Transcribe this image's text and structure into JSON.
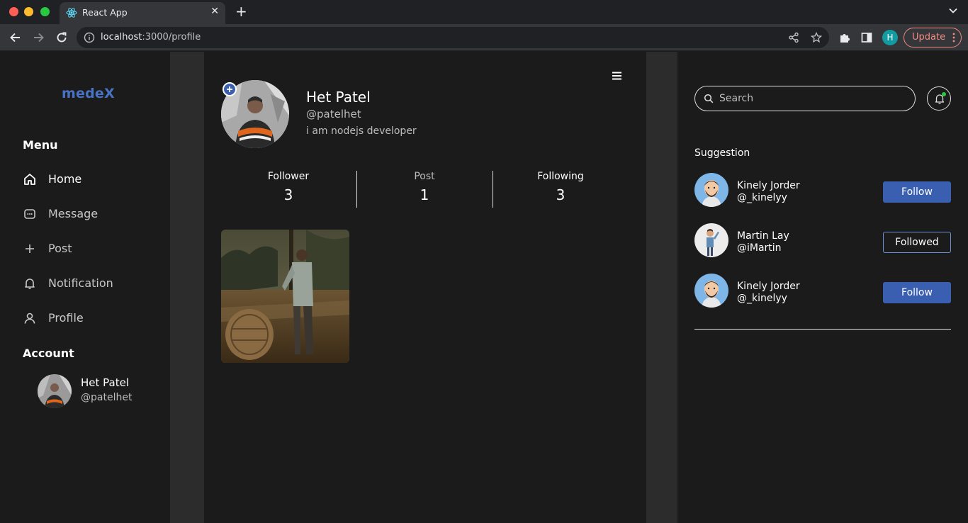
{
  "browser": {
    "tab_title": "React App",
    "url_host": "localhost",
    "url_rest": ":3000/profile",
    "profile_initial": "H",
    "update_label": "Update"
  },
  "app": {
    "logo": "medeX",
    "menu_heading": "Menu",
    "menu": [
      {
        "label": "Home"
      },
      {
        "label": "Message"
      },
      {
        "label": "Post"
      },
      {
        "label": "Notification"
      },
      {
        "label": "Profile"
      }
    ],
    "account_heading": "Account",
    "account": {
      "name": "Het Patel",
      "handle": "@patelhet"
    }
  },
  "profile": {
    "name": "Het Patel",
    "handle": "@patelhet",
    "bio": "i am nodejs developer",
    "stats": [
      {
        "label": "Follower",
        "value": "3"
      },
      {
        "label": "Post",
        "value": "1"
      },
      {
        "label": "Following",
        "value": "3"
      }
    ]
  },
  "right": {
    "search_placeholder": "Search",
    "suggestion_title": "Suggestion",
    "suggestions": [
      {
        "name": "Kinely Jorder",
        "handle": "@_kinelyy",
        "button": "Follow"
      },
      {
        "name": "Martin Lay",
        "handle": "@iMartin",
        "button": "Followed"
      },
      {
        "name": "Kinely Jorder",
        "handle": "@_kinelyy",
        "button": "Follow"
      }
    ]
  },
  "colors": {
    "accent": "#3b5fb0",
    "logo": "#4a72c4",
    "background": "#1b1b1c",
    "gutter": "#2c2c2d",
    "notification_dot": "#27c93f"
  }
}
